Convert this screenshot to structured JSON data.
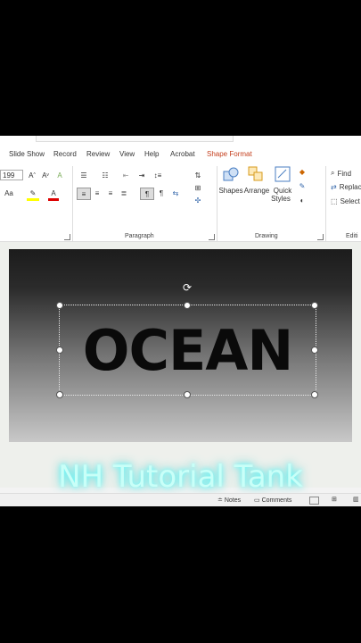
{
  "tabs": [
    {
      "label": "Slide Show"
    },
    {
      "label": "Record"
    },
    {
      "label": "Review"
    },
    {
      "label": "View"
    },
    {
      "label": "Help"
    },
    {
      "label": "Acrobat"
    },
    {
      "label": "Shape Format"
    }
  ],
  "accent_color": "#c43e1c",
  "font": {
    "size_value": "199"
  },
  "groups": {
    "paragraph": "Paragraph",
    "drawing": "Drawing",
    "editing": "Editi"
  },
  "drawing": {
    "shapes": "Shapes",
    "arrange": "Arrange",
    "quick_styles_1": "Quick",
    "quick_styles_2": "Styles"
  },
  "editing": {
    "find": "Find",
    "replace": "Replac",
    "select": "Select"
  },
  "slide": {
    "text": "OCEAN"
  },
  "watermark": "NH Tutorial Tank",
  "status": {
    "notes": "Notes",
    "comments": "Comments"
  },
  "icons": [
    "bullets-icon",
    "numbering-icon",
    "align-left-icon",
    "shapes-icon",
    "arrange-icon",
    "quick-styles-icon",
    "find-icon",
    "rotate-icon"
  ]
}
